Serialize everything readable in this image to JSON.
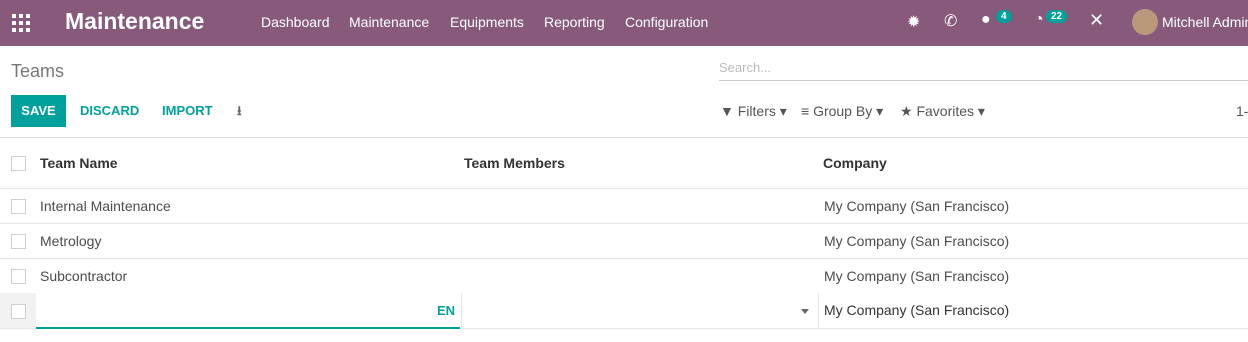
{
  "app": {
    "title": "Maintenance"
  },
  "nav": {
    "items": [
      "Dashboard",
      "Maintenance",
      "Equipments",
      "Reporting",
      "Configuration"
    ]
  },
  "systray": {
    "messages_count": "4",
    "activities_count": "22",
    "user_name": "Mitchell Admin"
  },
  "breadcrumb": {
    "title": "Teams"
  },
  "search": {
    "placeholder": "Search..."
  },
  "buttons": {
    "save": "SAVE",
    "discard": "DISCARD",
    "import": "IMPORT"
  },
  "filters": {
    "filters": "Filters",
    "group_by": "Group By",
    "favorites": "Favorites"
  },
  "pager": {
    "text": "1-"
  },
  "table": {
    "headers": [
      "Team Name",
      "Team Members",
      "Company"
    ],
    "rows": [
      {
        "name": "Internal Maintenance",
        "members": "",
        "company": "My Company (San Francisco)"
      },
      {
        "name": "Metrology",
        "members": "",
        "company": "My Company (San Francisco)"
      },
      {
        "name": "Subcontractor",
        "members": "",
        "company": "My Company (San Francisco)"
      }
    ],
    "edit_row": {
      "lang": "EN",
      "company": "My Company (San Francisco)"
    }
  },
  "colors": {
    "brand": "#875a7b",
    "accent": "#00a09d"
  }
}
